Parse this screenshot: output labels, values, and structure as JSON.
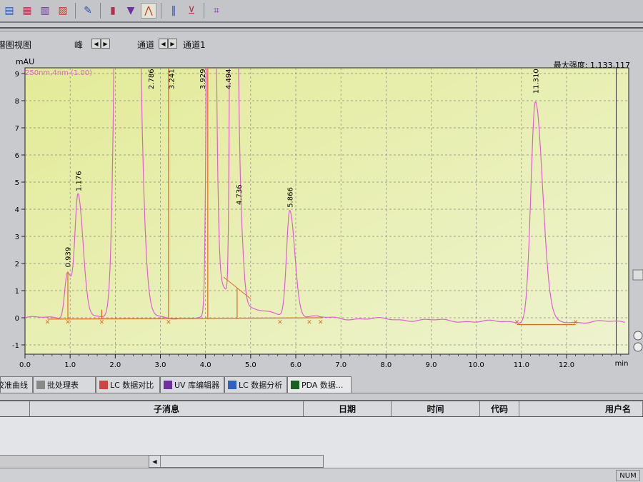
{
  "toolbar": {
    "icons": [
      "instrument-icon",
      "print-icon",
      "batch-icon",
      "report-icon",
      "edit-icon",
      "chromatogram-view-icon",
      "spectrum-view-icon",
      "peak-icon",
      "column-icon",
      "autosampler-icon",
      "method-icon"
    ],
    "active_icon": "peak-icon"
  },
  "viewbar": {
    "view_title": "谱图视图",
    "peak_label": "峰",
    "channel_label": "通道",
    "channel_value": "通道1"
  },
  "chart": {
    "max_intensity_label": "最大强度:",
    "max_intensity_value": "1,133,117",
    "trace_label": "250nm,4nm (1.00)"
  },
  "chart_data": {
    "type": "line",
    "xlabel": "min",
    "ylabel": "mAU",
    "xlim": [
      0,
      13.3
    ],
    "ylim": [
      -1.4,
      9.2
    ],
    "x_ticks": [
      "0.0",
      "1.0",
      "2.0",
      "3.0",
      "4.0",
      "5.0",
      "6.0",
      "7.0",
      "8.0",
      "9.0",
      "10.0",
      "11.0",
      "12.0"
    ],
    "y_ticks": [
      "-1",
      "0",
      "1",
      "2",
      "3",
      "4",
      "5",
      "6",
      "7",
      "8",
      "9"
    ],
    "grid": true,
    "peaks": [
      {
        "rt": "0.939",
        "time": 0.939,
        "height": 1.7
      },
      {
        "rt": "1.176",
        "time": 1.176,
        "height": 4.5
      },
      {
        "rt": "",
        "time": 2.2,
        "height": 60
      },
      {
        "rt": "2.786",
        "time": 2.786,
        "height": 30
      },
      {
        "rt": "3.241",
        "time": 3.241,
        "height": 30
      },
      {
        "rt": "3.929",
        "time": 4.1,
        "height": 40
      },
      {
        "rt": "4.494",
        "time": 4.6,
        "height": 40
      },
      {
        "rt": "4.736",
        "time": 4.736,
        "height": 4.0
      },
      {
        "rt": "5.866",
        "time": 5.866,
        "height": 3.9
      },
      {
        "rt": "11.310",
        "time": 11.31,
        "height": 8.1
      }
    ],
    "colors": {
      "trace": "#e060d0",
      "baseline": "#e06a20",
      "background": "#eaf0b8"
    }
  },
  "tabs": [
    {
      "label": "校准曲线",
      "icon": "calibration-icon"
    },
    {
      "label": "批处理表",
      "icon": "batch-table-icon"
    },
    {
      "label": "LC 数据对比",
      "icon": "compare-icon"
    },
    {
      "label": "UV 库编辑器",
      "icon": "library-icon"
    },
    {
      "label": "LC 数据分析",
      "icon": "analysis-icon"
    },
    {
      "label": "PDA 数据...",
      "icon": "pda-icon"
    }
  ],
  "table": {
    "columns": [
      "",
      "子消息",
      "日期",
      "时间",
      "代码",
      "用户名"
    ]
  },
  "status": {
    "num": "NUM"
  }
}
